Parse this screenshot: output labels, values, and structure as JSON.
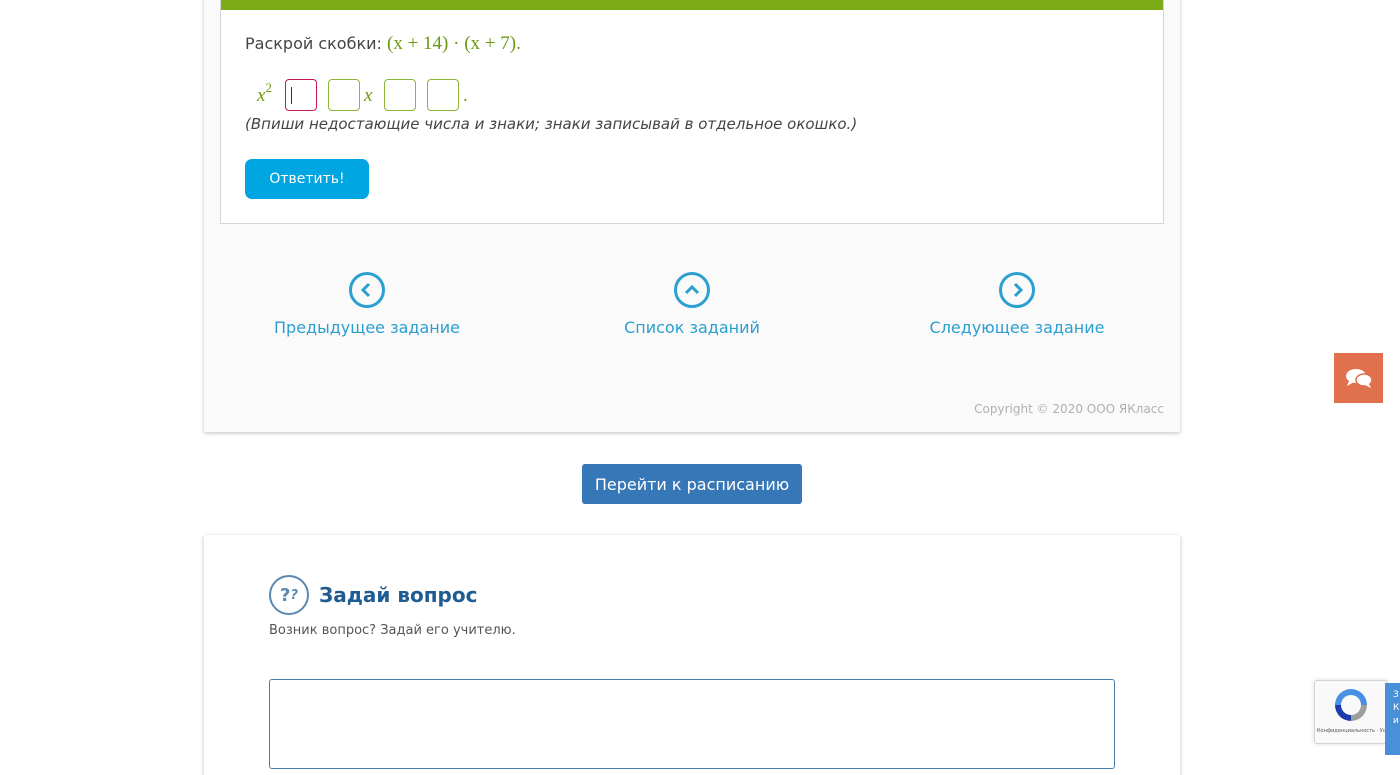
{
  "task": {
    "prompt_label": "Раскрой скобки:",
    "expression": "(x + 14) · (x + 7).",
    "answer_prefix_var": "x",
    "answer_prefix_exp": "2",
    "answer_mid_var": "x",
    "answer_end": ".",
    "hint": "(Впиши недостающие числа и знаки; знаки записывай в отдельное окошко.)",
    "submit_label": "Ответить!"
  },
  "nav": {
    "prev_label": "Предыдущее задание",
    "list_label": "Список заданий",
    "next_label": "Следующее задание"
  },
  "copyright": "Copyright © 2020 ООО ЯКласс",
  "schedule_button": "Перейти к расписанию",
  "question": {
    "icon_text": "?",
    "title": "Задай вопрос",
    "subtitle": "Возник вопрос? Задай его учителю.",
    "textarea_value": ""
  },
  "recaptcha": {
    "footer_text": "Конфиденциальность · Условия использования"
  },
  "side_tab": {
    "text": "З К и"
  },
  "colors": {
    "accent_green": "#7cac18",
    "link_blue": "#2a9fd0",
    "button_cyan": "#00a6e2",
    "button_blue": "#3577b7",
    "chat_orange": "#e0704e"
  }
}
